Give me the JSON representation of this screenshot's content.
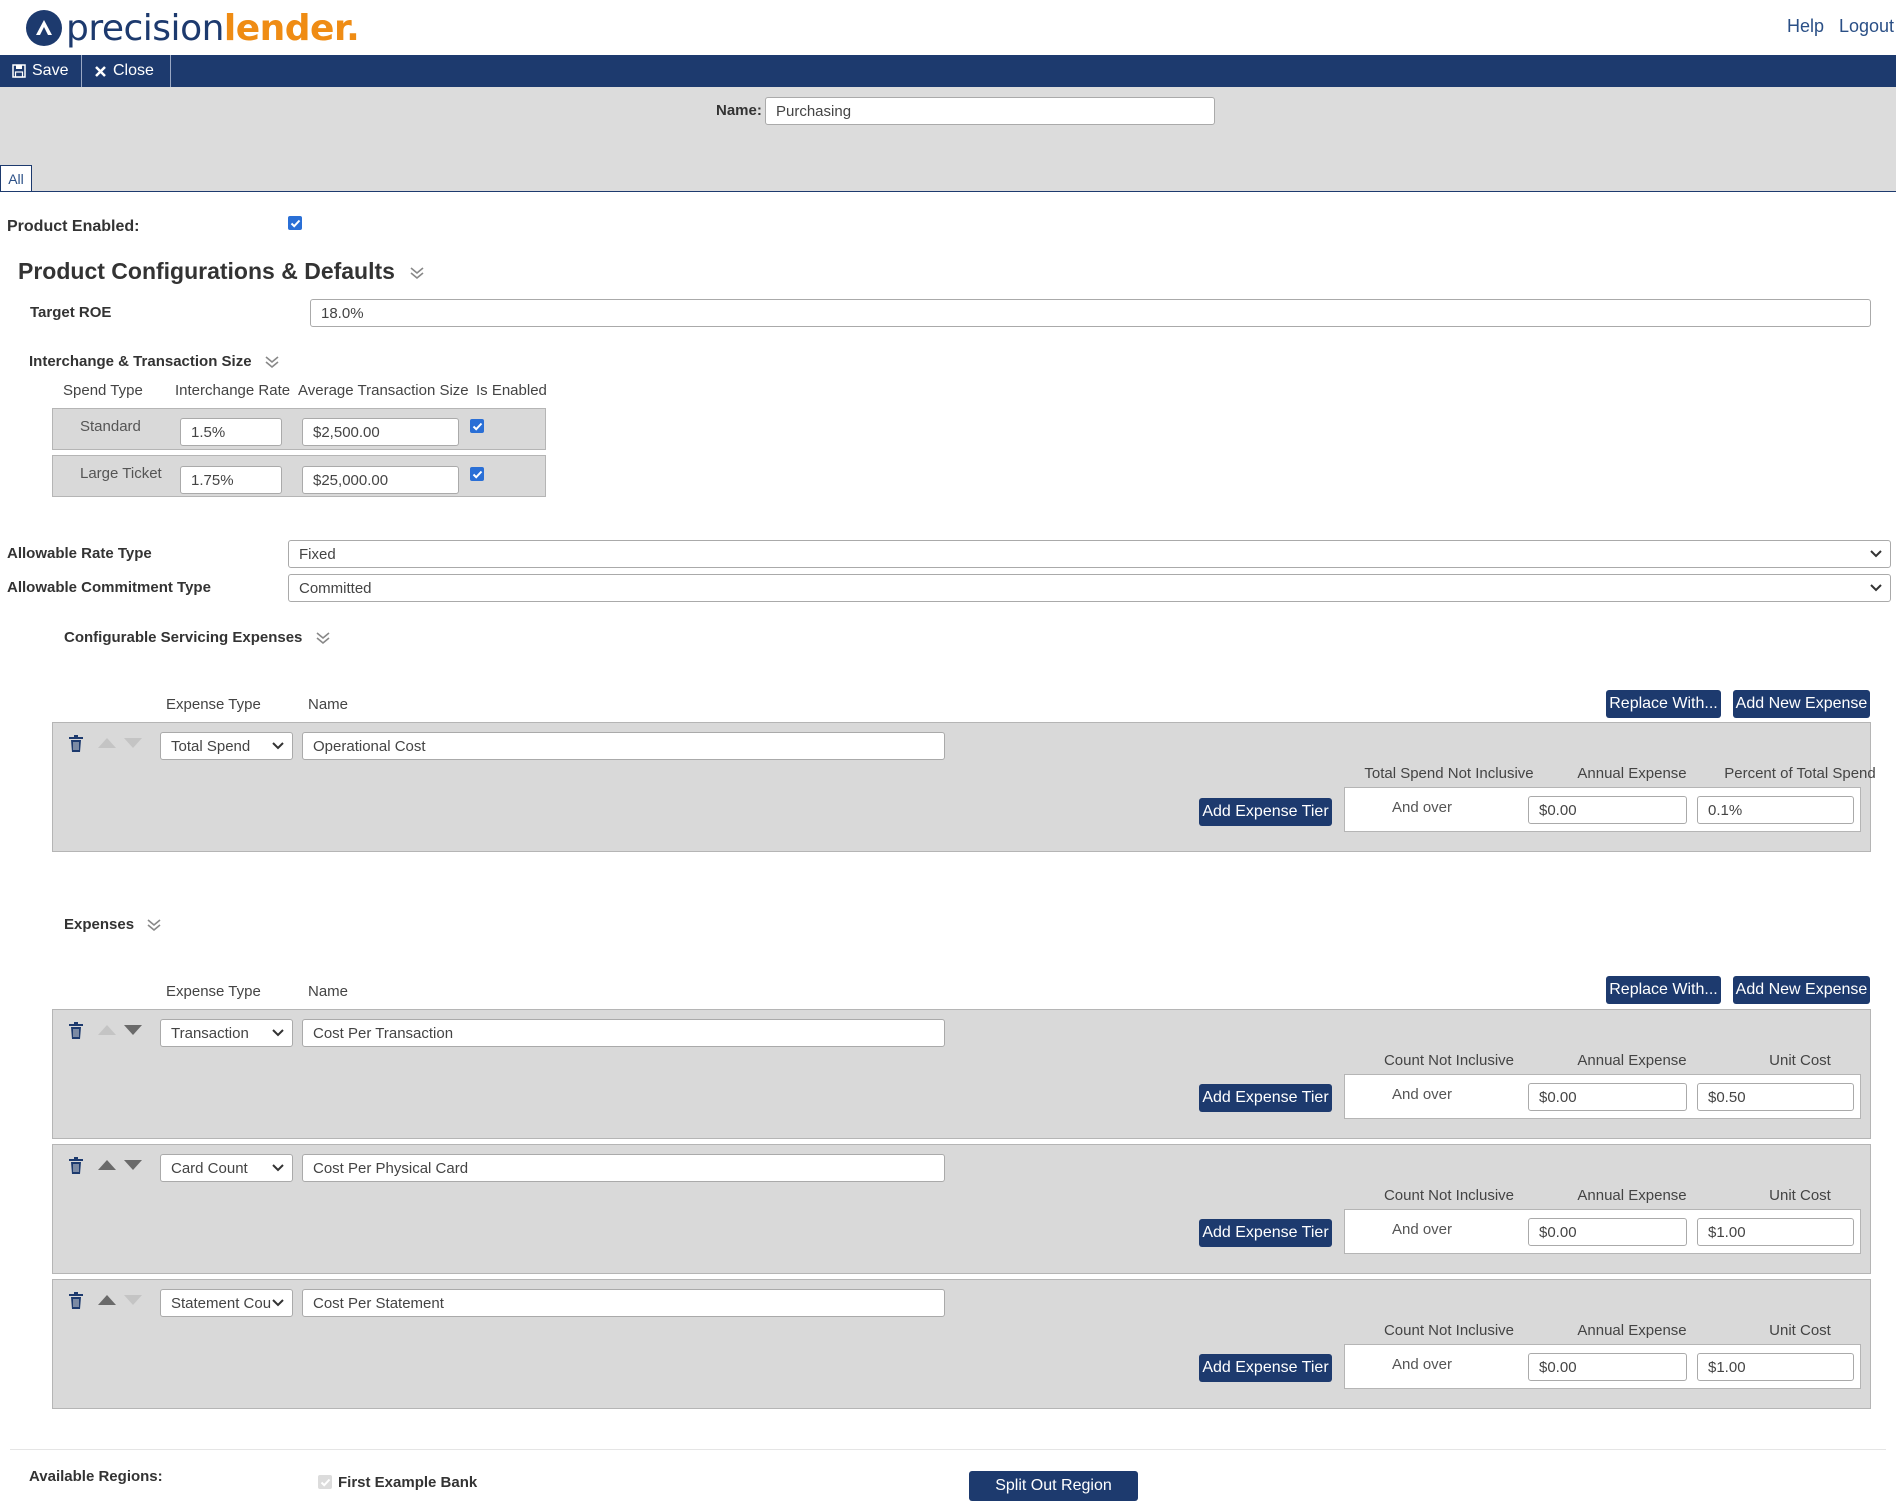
{
  "header": {
    "logo_part1": "precision",
    "logo_part2": "lender.",
    "help_label": "Help",
    "logout_label": "Logout"
  },
  "toolbar": {
    "save_label": "Save",
    "close_label": "Close"
  },
  "name_field": {
    "label": "Name:",
    "value": "Purchasing"
  },
  "tabs": [
    {
      "label": "All"
    }
  ],
  "product_enabled": {
    "label": "Product Enabled:",
    "checked": true
  },
  "config": {
    "title": "Product Configurations & Defaults",
    "target_roe": {
      "label": "Target ROE",
      "value": "18.0%"
    },
    "interchange": {
      "title": "Interchange & Transaction Size",
      "headers": [
        "Spend Type",
        "Interchange Rate",
        "Average Transaction Size",
        "Is Enabled"
      ],
      "rows": [
        {
          "spend_type": "Standard",
          "rate": "1.5%",
          "avg_size": "$2,500.00",
          "enabled": true
        },
        {
          "spend_type": "Large Ticket",
          "rate": "1.75%",
          "avg_size": "$25,000.00",
          "enabled": true
        }
      ]
    },
    "allowable_rate_type": {
      "label": "Allowable Rate Type",
      "value": "Fixed"
    },
    "allowable_commitment_type": {
      "label": "Allowable Commitment Type",
      "value": "Committed"
    }
  },
  "servicing": {
    "title": "Configurable Servicing Expenses",
    "col_expense_type": "Expense Type",
    "col_name": "Name",
    "replace_label": "Replace With...",
    "add_label": "Add New Expense",
    "items": [
      {
        "expense_type": "Total Spend",
        "name": "Operational Cost",
        "add_tier_label": "Add Expense Tier",
        "tier_headers": [
          "Total Spend Not Inclusive",
          "Annual Expense",
          "Percent of Total Spend"
        ],
        "tier": {
          "threshold": "And over",
          "annual_expense": "$0.00",
          "value": "0.1%"
        }
      }
    ]
  },
  "expenses": {
    "title": "Expenses",
    "col_expense_type": "Expense Type",
    "col_name": "Name",
    "replace_label": "Replace With...",
    "add_label": "Add New Expense",
    "items": [
      {
        "expense_type": "Transaction",
        "name": "Cost Per Transaction",
        "add_tier_label": "Add Expense Tier",
        "tier_headers": [
          "Count Not Inclusive",
          "Annual Expense",
          "Unit Cost"
        ],
        "tier": {
          "threshold": "And over",
          "annual_expense": "$0.00",
          "value": "$0.50"
        }
      },
      {
        "expense_type": "Card Count",
        "name": "Cost Per Physical Card",
        "add_tier_label": "Add Expense Tier",
        "tier_headers": [
          "Count Not Inclusive",
          "Annual Expense",
          "Unit Cost"
        ],
        "tier": {
          "threshold": "And over",
          "annual_expense": "$0.00",
          "value": "$1.00"
        }
      },
      {
        "expense_type": "Statement Cou",
        "name": "Cost Per Statement",
        "add_tier_label": "Add Expense Tier",
        "tier_headers": [
          "Count Not Inclusive",
          "Annual Expense",
          "Unit Cost"
        ],
        "tier": {
          "threshold": "And over",
          "annual_expense": "$0.00",
          "value": "$1.00"
        }
      }
    ]
  },
  "regions": {
    "label": "Available Regions:",
    "items": [
      {
        "name": "First Example Bank",
        "checked": true
      }
    ],
    "split_label": "Split Out Region"
  },
  "colors": {
    "navy": "#1d3a6e",
    "orange": "#ef8c14",
    "panel_gray": "#d9d9d9",
    "checkbox_blue": "#2a6fd6"
  },
  "icons": [
    "save-icon",
    "close-icon",
    "chevron-double-down-icon",
    "trash-icon",
    "arrow-up-icon",
    "arrow-down-icon",
    "select-caret-icon"
  ]
}
